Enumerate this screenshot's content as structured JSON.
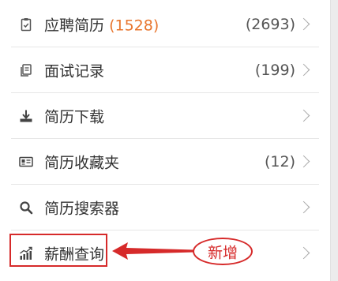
{
  "menu": {
    "items": [
      {
        "label": "应聘简历",
        "label_highlight": "(1528)",
        "count": "(2693)",
        "icon": "clipboard-check-icon"
      },
      {
        "label": "面试记录",
        "label_highlight": "",
        "count": "(199)",
        "icon": "document-copy-icon"
      },
      {
        "label": "简历下载",
        "label_highlight": "",
        "count": "",
        "icon": "download-icon"
      },
      {
        "label": "简历收藏夹",
        "label_highlight": "",
        "count": "(12)",
        "icon": "id-card-icon"
      },
      {
        "label": "简历搜索器",
        "label_highlight": "",
        "count": "",
        "icon": "search-icon"
      },
      {
        "label": "薪酬查询",
        "label_highlight": "",
        "count": "",
        "icon": "bar-chart-trend-icon"
      }
    ]
  },
  "annotation": {
    "new_label": "新增"
  },
  "colors": {
    "highlight": "#e8752d",
    "annotation_red": "#d62a2a",
    "text": "#333333",
    "count_text": "#555555",
    "chevron": "#a8a8a8"
  }
}
